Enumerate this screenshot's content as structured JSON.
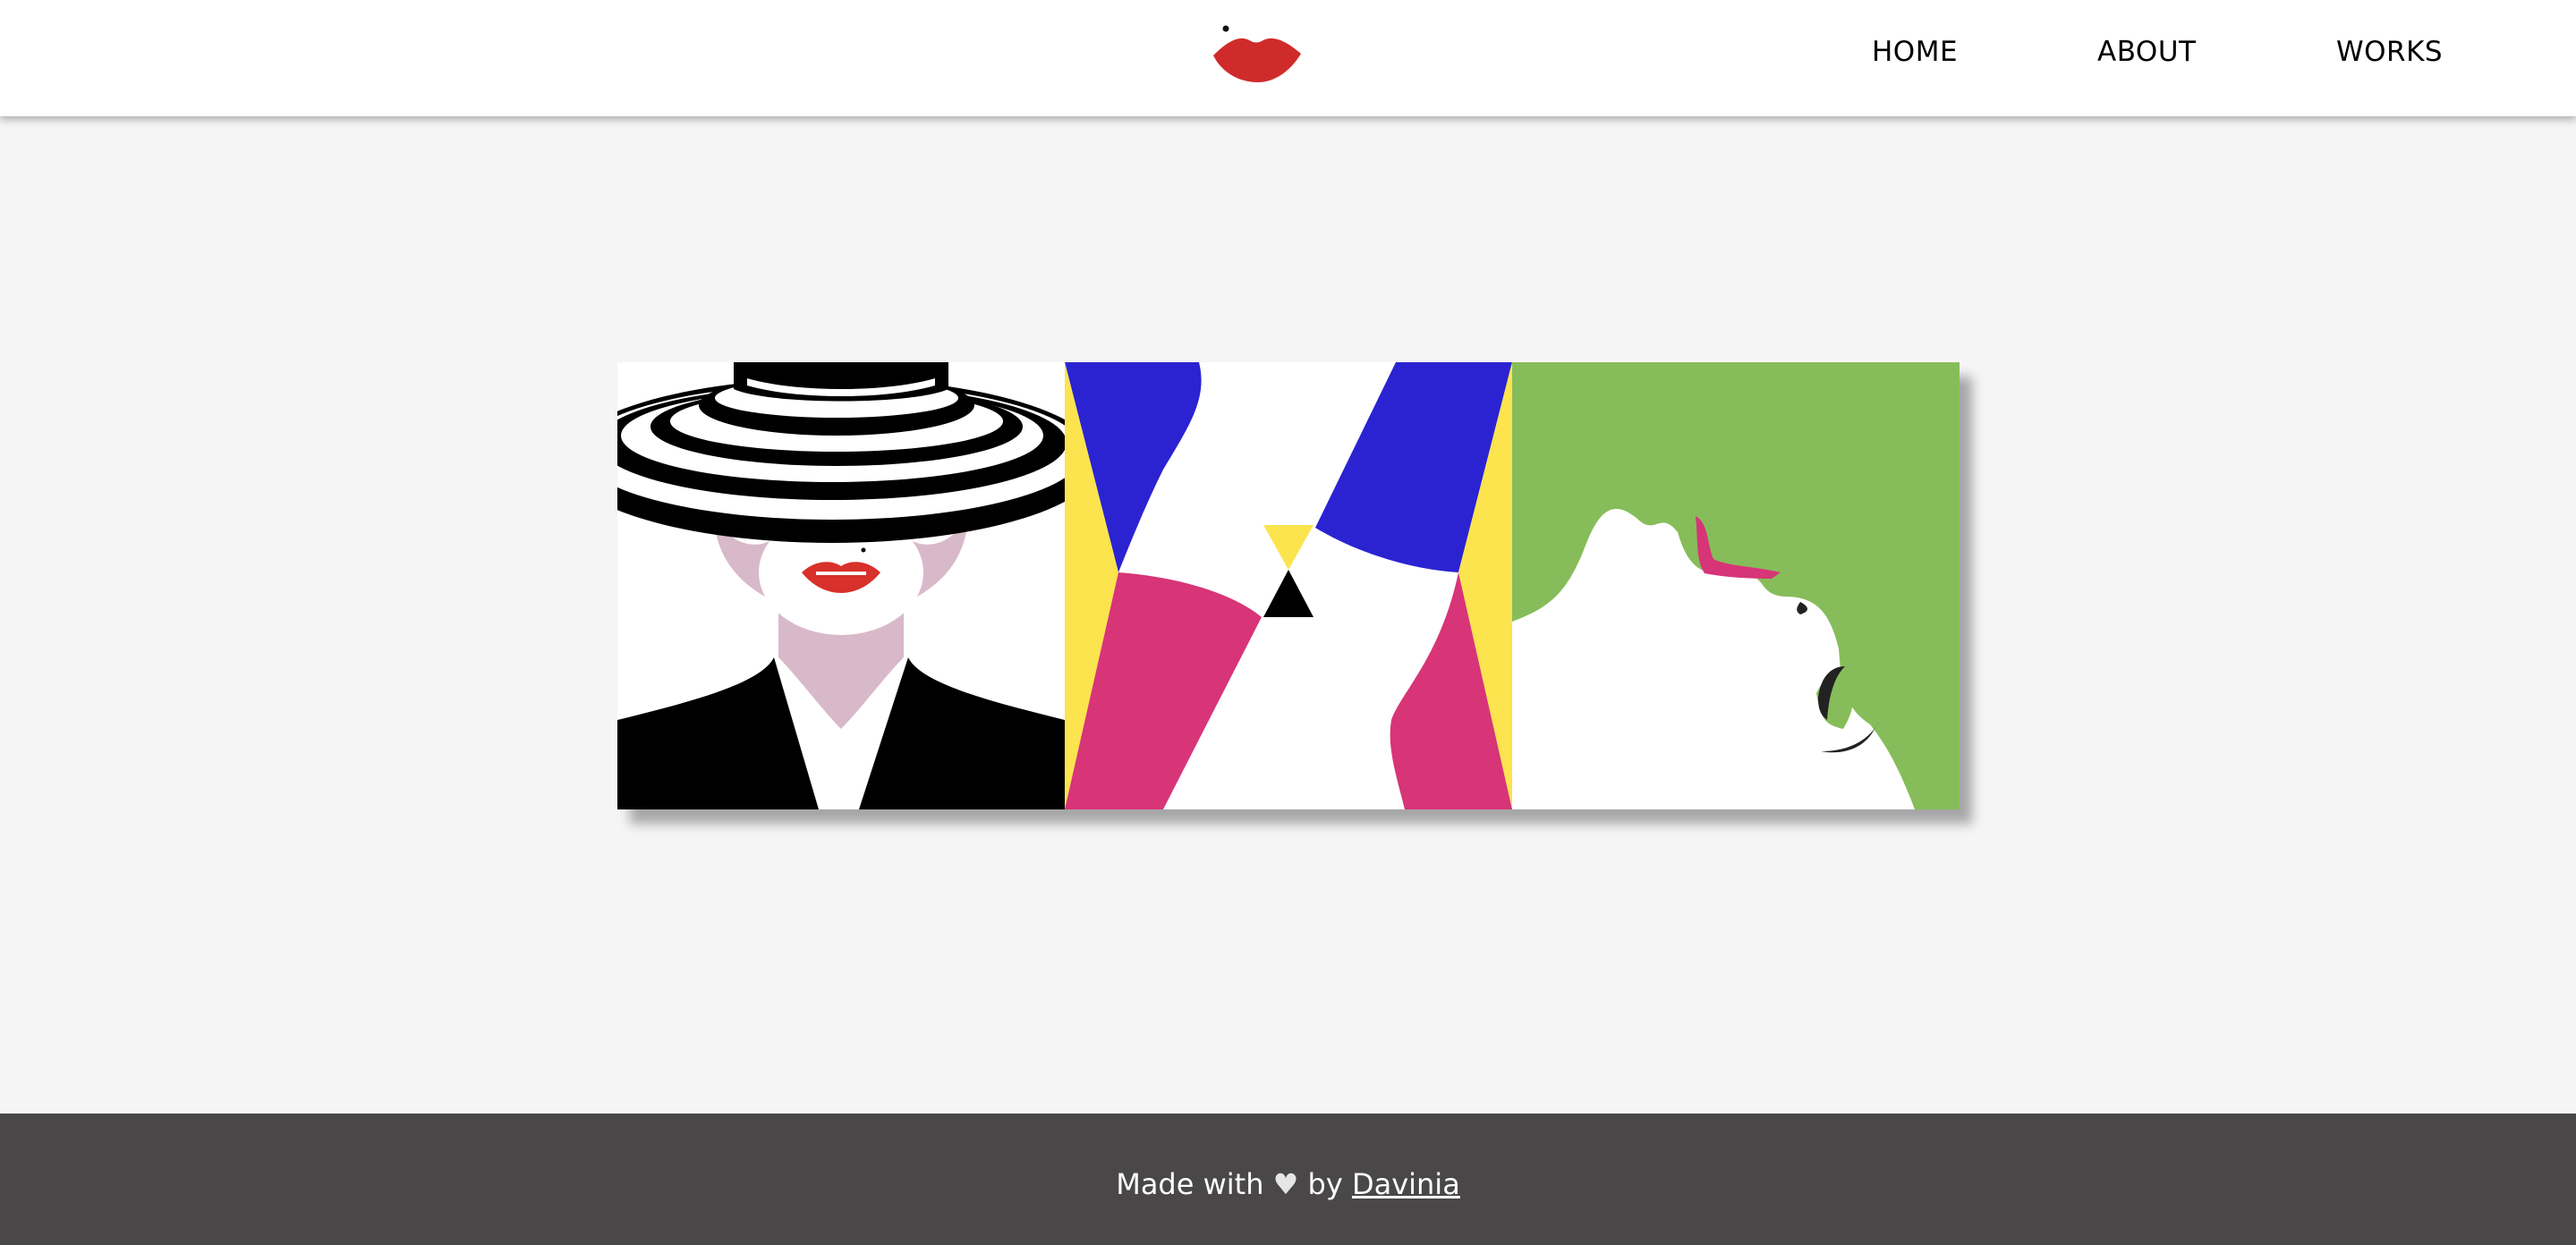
{
  "header": {
    "logo_icon": "lips-icon",
    "nav": [
      {
        "label": "HOME"
      },
      {
        "label": "ABOUT"
      },
      {
        "label": "WORKS"
      }
    ]
  },
  "gallery": {
    "items": [
      {
        "icon": "woman-in-striped-hat-artwork"
      },
      {
        "icon": "geometric-abstract-artwork"
      },
      {
        "icon": "green-hair-profile-artwork"
      }
    ]
  },
  "footer": {
    "made_with": "Made with",
    "heart": "♥",
    "by": "by",
    "author": "Davinia"
  },
  "colors": {
    "accent_red": "#d02b2b",
    "blue": "#2b23d1",
    "pink": "#d83478",
    "yellow": "#fbe44e",
    "green": "#86bd5a",
    "footer_bg": "#494748",
    "page_bg": "#f5f5f5"
  }
}
